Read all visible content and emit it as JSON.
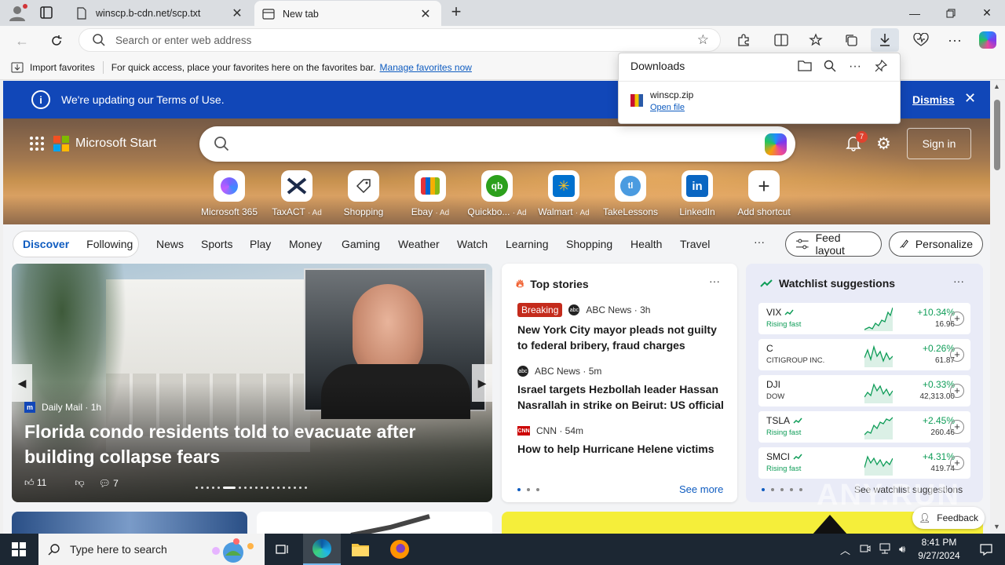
{
  "browser": {
    "tabs": [
      {
        "label": "winscp.b-cdn.net/scp.txt"
      },
      {
        "label": "New tab"
      }
    ],
    "address_placeholder": "Search or enter web address",
    "favorites_bar": {
      "import_label": "Import favorites",
      "hint_text": "For quick access, place your favorites here on the favorites bar.",
      "manage_link": "Manage favorites now"
    }
  },
  "downloads": {
    "title": "Downloads",
    "file_name": "winscp.zip",
    "open_label": "Open file"
  },
  "banner": {
    "message": "We're updating our Terms of Use.",
    "dismiss_label": "Dismiss"
  },
  "start": {
    "brand": "Microsoft Start",
    "notification_count": "7",
    "signin_label": "Sign in",
    "shortcuts": [
      {
        "label": "Microsoft 365",
        "ad": ""
      },
      {
        "label": "TaxACT",
        "ad": "· Ad"
      },
      {
        "label": "Shopping",
        "ad": ""
      },
      {
        "label": "Ebay",
        "ad": "· Ad"
      },
      {
        "label": "Quickbo...",
        "ad": "· Ad"
      },
      {
        "label": "Walmart",
        "ad": "· Ad"
      },
      {
        "label": "TakeLessons",
        "ad": ""
      },
      {
        "label": "LinkedIn",
        "ad": ""
      },
      {
        "label": "Add shortcut",
        "ad": ""
      }
    ]
  },
  "nav": {
    "discover": "Discover",
    "following": "Following",
    "links": [
      "News",
      "Sports",
      "Play",
      "Money",
      "Gaming",
      "Weather",
      "Watch",
      "Learning",
      "Shopping",
      "Health",
      "Travel"
    ],
    "more": "···",
    "feed_layout": "Feed layout",
    "personalize": "Personalize"
  },
  "hero_story": {
    "source": "Daily Mail",
    "age": "· 1h",
    "headline": "Florida condo residents told to evacuate after building collapse fears",
    "likes": "11",
    "comments": "7"
  },
  "top_stories": {
    "title": "Top stories",
    "items": [
      {
        "badge": "Breaking",
        "source": "ABC News",
        "age": "· 3h",
        "title": "New York City mayor pleads not guilty to federal bribery, fraud charges"
      },
      {
        "badge": "",
        "source": "ABC News",
        "age": "· 5m",
        "title": "Israel targets Hezbollah leader Hassan Nasrallah in strike on Beirut: US official"
      },
      {
        "badge": "",
        "source": "CNN",
        "age": "· 54m",
        "title": "How to help Hurricane Helene victims"
      }
    ],
    "see_more": "See more"
  },
  "watchlist": {
    "title": "Watchlist suggestions",
    "items": [
      {
        "symbol": "VIX",
        "sub": "Rising fast",
        "change": "+10.34%",
        "price": "16.96"
      },
      {
        "symbol": "C",
        "sub": "CITIGROUP INC.",
        "change": "+0.26%",
        "price": "61.87"
      },
      {
        "symbol": "DJI",
        "sub": "DOW",
        "change": "+0.33%",
        "price": "42,313.00"
      },
      {
        "symbol": "TSLA",
        "sub": "Rising fast",
        "change": "+2.45%",
        "price": "260.46"
      },
      {
        "symbol": "SMCI",
        "sub": "Rising fast",
        "change": "+4.31%",
        "price": "419.74"
      }
    ],
    "see_all": "See watchlist suggestions"
  },
  "feedback_label": "Feedback",
  "taskbar": {
    "search_placeholder": "Type here to search",
    "time": "8:41 PM",
    "date": "9/27/2024"
  },
  "watermark": "ANY.RUN",
  "colors": {
    "accent": "#0f5cc0",
    "banner_bg": "#1147b8",
    "positive": "#0f9d58",
    "breaking": "#c42b1c"
  }
}
